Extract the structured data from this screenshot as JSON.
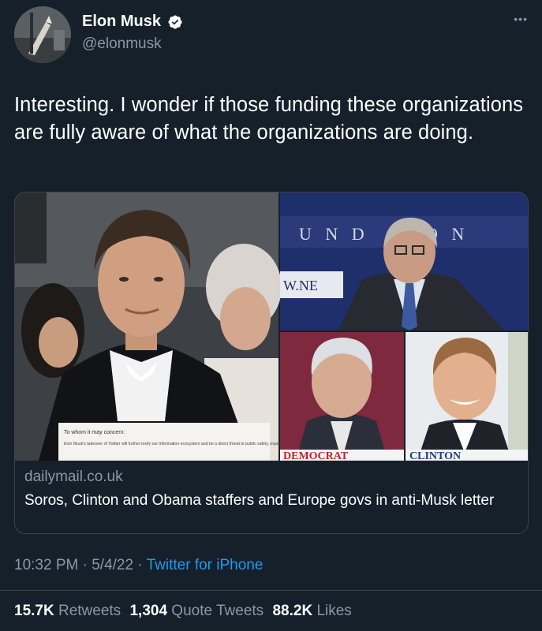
{
  "author": {
    "display_name": "Elon Musk",
    "handle": "@elonmusk",
    "avatar_icon": "rocket-avatar-icon",
    "verified_icon": "verified-badge-icon"
  },
  "more_icon": "more-dots-icon",
  "tweet": {
    "text": "Interesting. I wonder if those funding these organizations are fully aware of what the organizations are doing."
  },
  "card": {
    "domain": "dailymail.co.uk",
    "title": "Soros, Clinton and Obama staffers and Europe govs in anti-Musk letter",
    "image_captions": {
      "letter_salutation": "To whom it may concern:",
      "letter_body": "Elon Musk's takeover of Twitter will further toxify our information ecosystem and be a direct threat to public safety, especially among those already most",
      "banner_democrat": "DEMOCRAT",
      "banner_clinton": "CLINTON"
    }
  },
  "meta": {
    "time": "10:32 PM",
    "separator": "·",
    "date": "5/4/22",
    "source": "Twitter for iPhone"
  },
  "stats": {
    "retweets_count": "15.7K",
    "retweets_label": "Retweets",
    "quotes_count": "1,304",
    "quotes_label": "Quote Tweets",
    "likes_count": "88.2K",
    "likes_label": "Likes"
  },
  "colors": {
    "background": "#15202b",
    "secondary_text": "#8b98a5",
    "link": "#1d9bf0",
    "border": "#38444d",
    "verified": "#1d9bf0"
  }
}
